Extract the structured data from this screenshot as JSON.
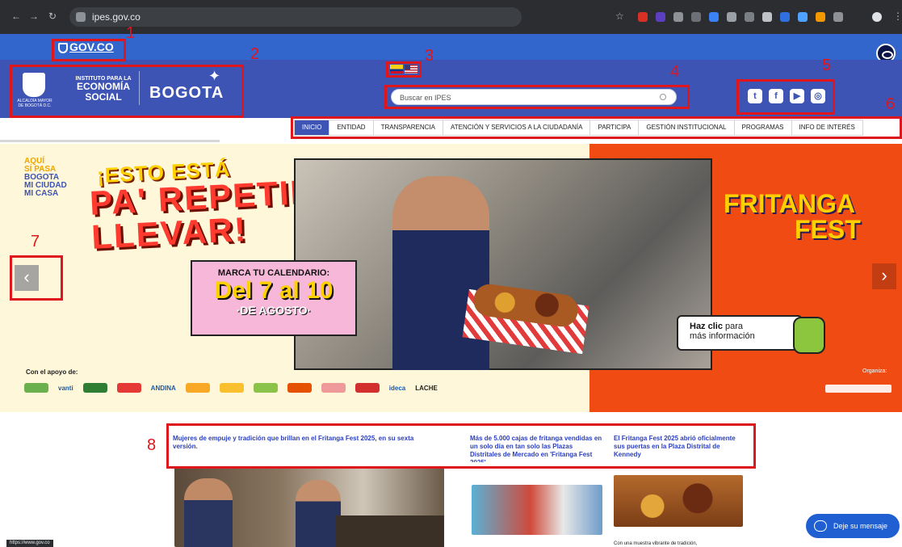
{
  "browser": {
    "url": "ipes.gov.co",
    "status_url": "https://www.gov.co"
  },
  "gov_bar": {
    "label": "GOV.CO"
  },
  "logos": {
    "alcaldia": "ALCALDÍA MAYOR DE BOGOTÁ D.C.",
    "ipes_line1": "INSTITUTO PARA LA",
    "ipes_line2": "ECONOMÍA",
    "ipes_line3": "SOCIAL",
    "bogota": "BOGOTA"
  },
  "search": {
    "placeholder": "Buscar en IPES"
  },
  "social": [
    {
      "name": "twitter-icon",
      "glyph": "t"
    },
    {
      "name": "facebook-icon",
      "glyph": "f"
    },
    {
      "name": "youtube-icon",
      "glyph": "▶"
    },
    {
      "name": "instagram-icon",
      "glyph": "◎"
    }
  ],
  "menu": [
    "INICIO",
    "ENTIDAD",
    "TRANSPARENCIA",
    "ATENCIÓN Y SERVICIOS A LA CIUDADANÍA",
    "PARTICIPA",
    "GESTIÓN INSTITUCIONAL",
    "PROGRAMAS",
    "INFO DE INTERÉS"
  ],
  "banner": {
    "aqui_line1": "AQUÍ",
    "aqui_line2": "SÍ PASA",
    "aqui_line3": "BOGOTA",
    "aqui_line4": "MI CIUDAD",
    "aqui_line5": "MI CASA",
    "headline_top": "¡ESTO ESTÁ",
    "headline_main": "PA' REPETIR Y LLEVAR!",
    "calendar_title": "MARCA TU CALENDARIO:",
    "calendar_dates": "Del 7 al 10",
    "calendar_month": "·DE AGOSTO·",
    "fest_line1": "FRITANGA",
    "fest_line2": "FEST",
    "cta_bold": "Haz clic",
    "cta_rest": " para",
    "cta_line2": "más información",
    "apoyo_label": "Con el apoyo de:",
    "sponsors": [
      "vanti",
      "ANDINA",
      "ideca",
      "LACHE"
    ],
    "organiza_label": "Organiza:",
    "prev_arrow": "‹",
    "next_arrow": "›"
  },
  "news": {
    "headline_1": "Mujeres de empuje y tradición que brillan en el Fritanga Fest 2025, en su sexta versión.",
    "headline_2": "Más de 5.000 cajas de fritanga vendidas en un solo día en tan solo las Plazas Distritales de Mercado en 'Fritanga Fest 2025'",
    "headline_3": "El Fritanga Fest 2025 abrió oficialmente sus puertas en la Plaza Distrital de Kennedy",
    "snippet_3": "Con una muestra vibrante de tradición,"
  },
  "chat": {
    "label": "Deje su mensaje"
  },
  "annotations": [
    "1",
    "2",
    "3",
    "4",
    "5",
    "6",
    "7",
    "8"
  ],
  "colors": {
    "gov_blue": "#3366cc",
    "header_blue": "#3d54b5",
    "annotation_red": "#e0161d",
    "banner_orange": "#f04b12"
  }
}
